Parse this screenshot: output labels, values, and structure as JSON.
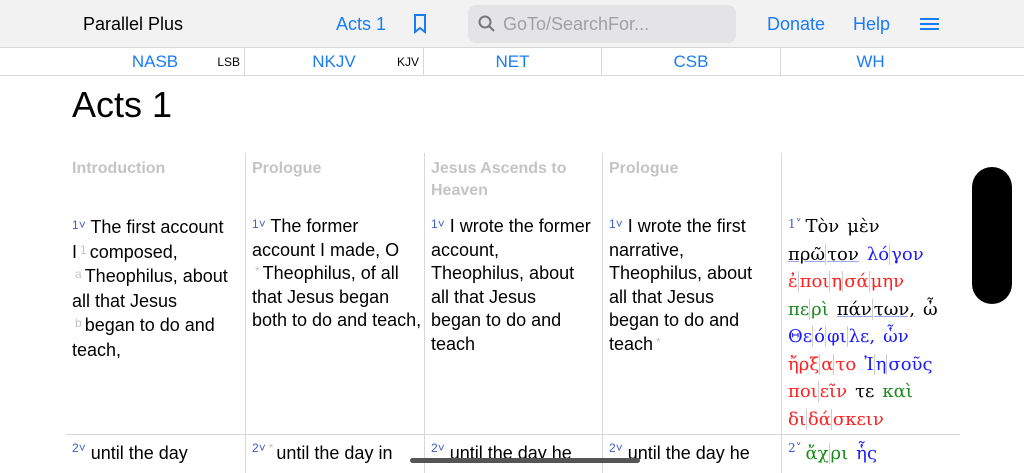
{
  "app": {
    "title": "Parallel Plus",
    "chapter": "Acts 1",
    "search_placeholder": "GoTo/SearchFor...",
    "donate": "Donate",
    "help": "Help"
  },
  "tabs": [
    {
      "label": "NASB",
      "alt": "LSB"
    },
    {
      "label": "NKJV",
      "alt": "KJV"
    },
    {
      "label": "NET",
      "alt": ""
    },
    {
      "label": "CSB",
      "alt": ""
    },
    {
      "label": "WH",
      "alt": ""
    }
  ],
  "page_title": "Acts 1",
  "columns": [
    {
      "section": "Introduction",
      "v1": {
        "num": "1",
        "parts": [
          "The first account I",
          "1",
          "composed,",
          "a",
          "Theophilus, about all that Jesus",
          "b",
          "began to do and teach,"
        ]
      },
      "v2": {
        "num": "2",
        "text": "until the day"
      }
    },
    {
      "section": "Prologue",
      "v1": {
        "num": "1",
        "parts": [
          "The former account I made, O",
          "*",
          "Theophilus, of all that Jesus began both to do and teach,"
        ]
      },
      "v2": {
        "num": "2",
        "mark": "*",
        "text": "until the day in"
      }
    },
    {
      "section": "Jesus Ascends to Heaven",
      "v1": {
        "num": "1",
        "text": "I wrote the former account, Theophilus, about all that Jesus began to do and teach"
      },
      "v2": {
        "num": "2",
        "text": "until the day he"
      }
    },
    {
      "section": "Prologue",
      "v1": {
        "num": "1",
        "text": "I wrote the first narrative, Theophilus, about all that Jesus began to do and teach",
        "mark": "*"
      },
      "v2": {
        "num": "2",
        "text": "until the day he"
      }
    }
  ],
  "greek": {
    "colors": {
      "black": "#000000",
      "blue": "#1a1aff",
      "red": "#ff2020",
      "green": "#1a8a1a"
    },
    "v1_num": "1",
    "lines": [
      [
        {
          "s": [
            "Τὸν"
          ],
          "c": "black"
        },
        {
          "s": [
            "μὲν"
          ],
          "c": "black"
        }
      ],
      [
        {
          "s": [
            "πρῶ",
            "τον"
          ],
          "c": "black",
          "ul": true
        },
        {
          "s": [
            "λό",
            "γον"
          ],
          "c": "blue"
        }
      ],
      [
        {
          "s": [
            "ἐ",
            "ποι",
            "η",
            "σά",
            "μην"
          ],
          "c": "red"
        }
      ],
      [
        {
          "s": [
            "πε",
            "ρὶ"
          ],
          "c": "green"
        },
        {
          "s": [
            "πάν",
            "των,"
          ],
          "c": "black",
          "ul": true
        },
        {
          "s": [
            "ὦ"
          ],
          "c": "black"
        }
      ],
      [
        {
          "s": [
            "Θε",
            "ό",
            "φι",
            "λε,"
          ],
          "c": "blue"
        },
        {
          "s": [
            "ὧν"
          ],
          "c": "blue"
        }
      ],
      [
        {
          "s": [
            "ἤρξ",
            "α",
            "το"
          ],
          "c": "red"
        },
        {
          "s": [
            "Ἰ",
            "η",
            "σοῦς"
          ],
          "c": "blue"
        }
      ],
      [
        {
          "s": [
            "ποι",
            "εῖν"
          ],
          "c": "red"
        },
        {
          "s": [
            "τε"
          ],
          "c": "black"
        },
        {
          "s": [
            "καὶ"
          ],
          "c": "green"
        }
      ],
      [
        {
          "s": [
            "δι",
            "δά",
            "σκειν"
          ],
          "c": "red"
        }
      ]
    ],
    "v2_num": "2",
    "v2": [
      {
        "s": [
          "ἄχ",
          "ρι"
        ],
        "c": "green"
      },
      {
        "s": [
          "ἧς"
        ],
        "c": "blue"
      }
    ]
  }
}
